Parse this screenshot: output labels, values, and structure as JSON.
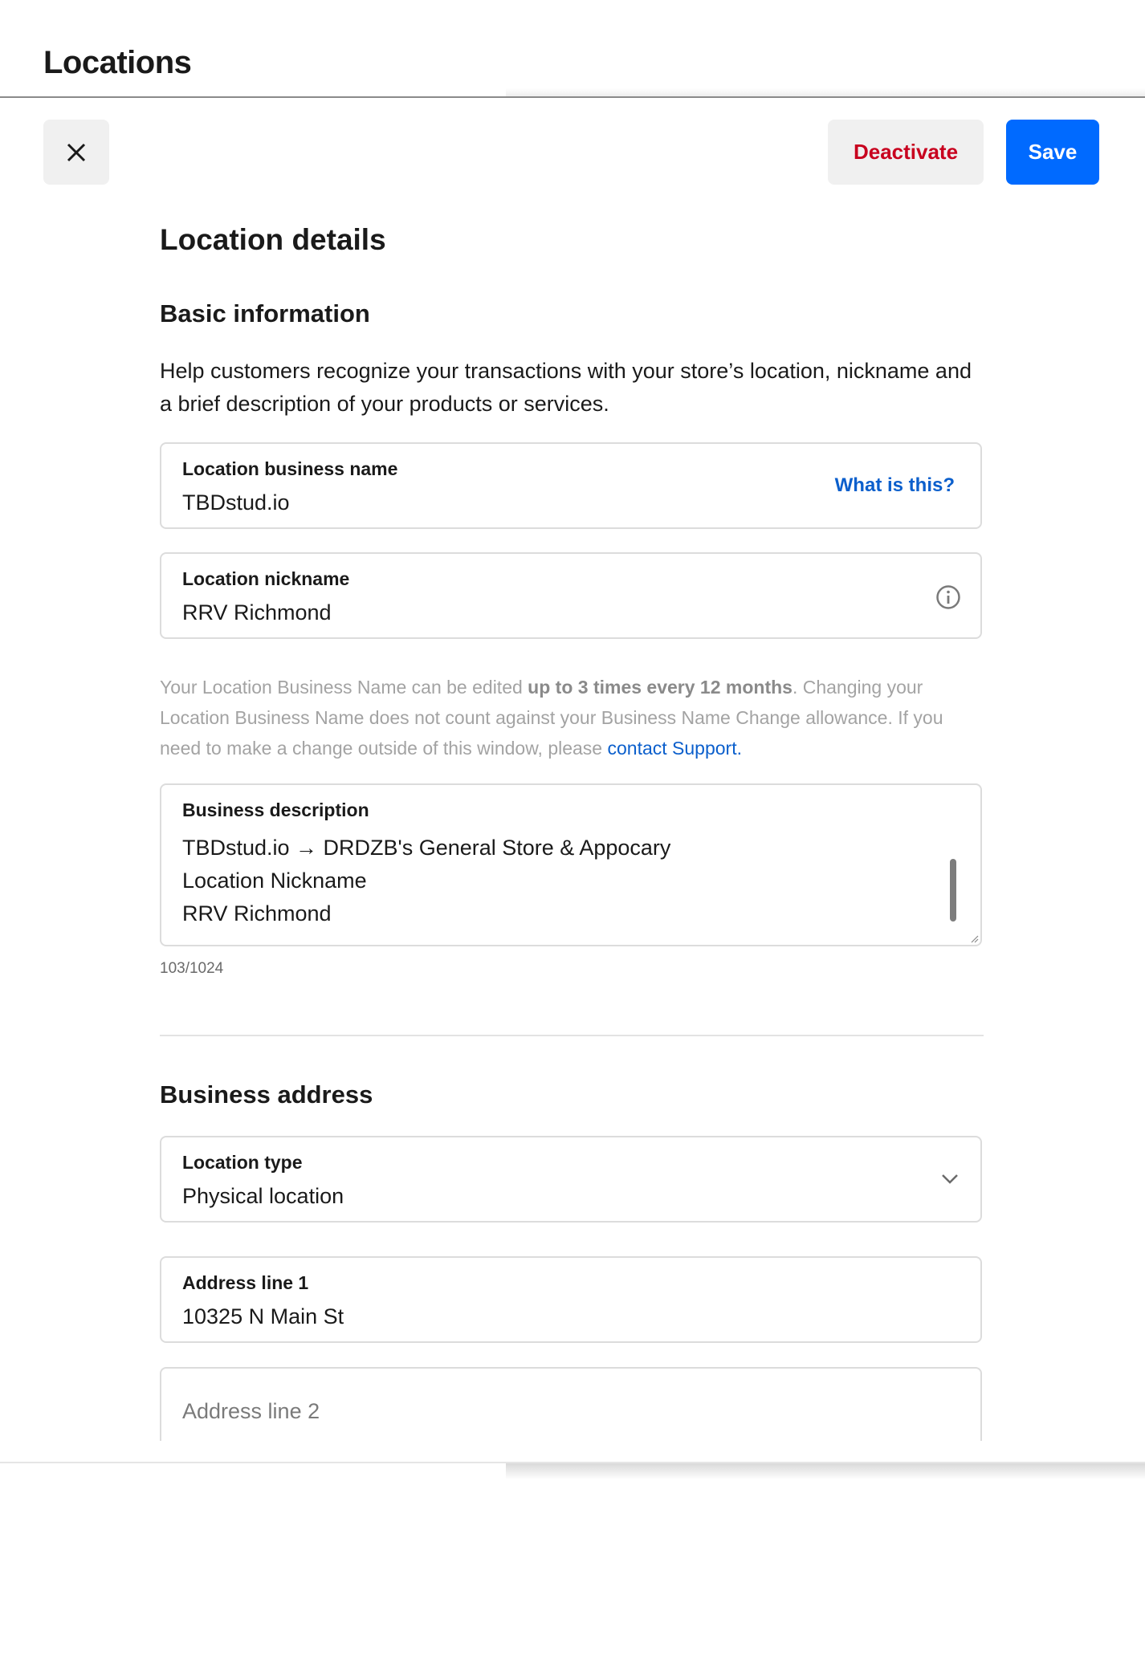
{
  "header": {
    "title": "Locations"
  },
  "toolbar": {
    "close_icon": "close-icon",
    "deactivate_label": "Deactivate",
    "save_label": "Save"
  },
  "main": {
    "title": "Location details",
    "basic": {
      "heading": "Basic information",
      "description": "Help customers recognize your transactions with your store’s location, nickname and a brief description of your products or services.",
      "business_name": {
        "label": "Location business name",
        "value": "TBDstud.io",
        "link": "What is this?"
      },
      "nickname": {
        "label": "Location nickname",
        "value": "RRV Richmond",
        "icon": "info-icon"
      },
      "help": {
        "part1": "Your Location Business Name can be edited ",
        "bold": "up to 3 times every 12 months",
        "part2": ". Changing your Location Business Name does not count against your Business Name Change allowance. If you need to make a change outside of this window, please ",
        "link": "contact Support."
      },
      "business_description": {
        "label": "Business description",
        "lines": [
          "TBDstud.io → DRDZB's General Store & Appocary",
          "Location Nickname",
          "RRV Richmond"
        ],
        "counter": "103/1024"
      }
    },
    "address": {
      "heading": "Business address",
      "location_type": {
        "label": "Location type",
        "value": "Physical location"
      },
      "address1": {
        "label": "Address line 1",
        "value": "10325 N Main St"
      },
      "address2": {
        "placeholder": "Address line 2"
      }
    }
  }
}
